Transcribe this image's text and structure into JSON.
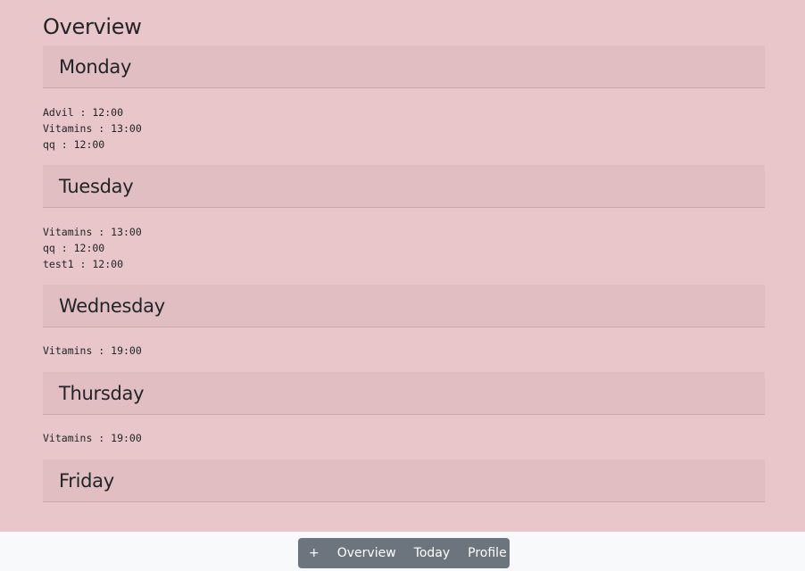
{
  "page": {
    "title": "Overview"
  },
  "days": [
    {
      "name": "Monday",
      "items": [
        "Advil : 12:00",
        "Vitamins : 13:00",
        "qq : 12:00"
      ]
    },
    {
      "name": "Tuesday",
      "items": [
        "Vitamins : 13:00",
        "qq : 12:00",
        "test1 : 12:00"
      ]
    },
    {
      "name": "Wednesday",
      "items": [
        "Vitamins : 19:00"
      ]
    },
    {
      "name": "Thursday",
      "items": [
        "Vitamins : 19:00"
      ]
    },
    {
      "name": "Friday",
      "items": []
    }
  ],
  "nav": {
    "add_label": "+",
    "overview_label": "Overview",
    "today_label": "Today",
    "profile_label": "Profile"
  },
  "colors": {
    "background": "#e8c6c9",
    "header_band": "#e0bec1",
    "nav_button": "#6c757d",
    "footer": "#f8f9fa"
  }
}
